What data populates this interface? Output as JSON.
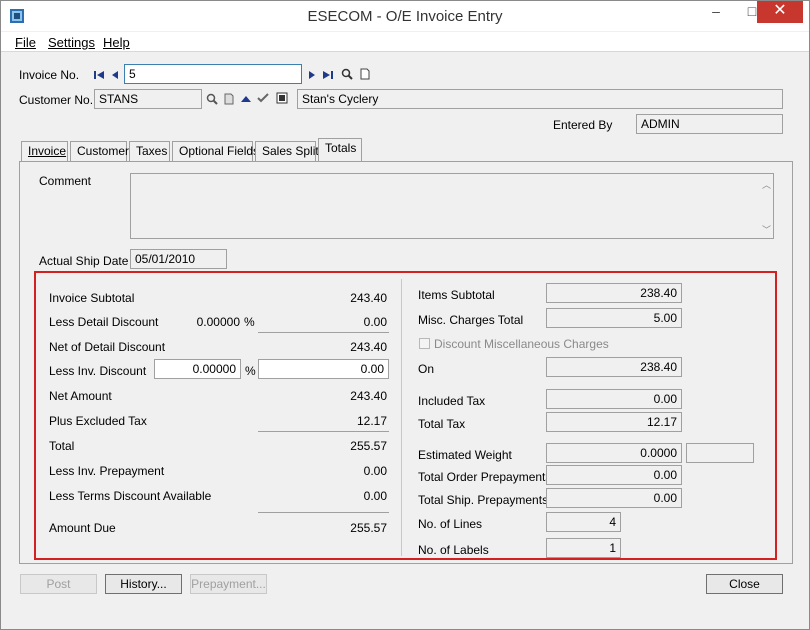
{
  "window": {
    "title": "ESECOM - O/E Invoice Entry",
    "min": "–",
    "max": "□",
    "close": "✕"
  },
  "menu": {
    "file": "File",
    "settings": "Settings",
    "help": "Help"
  },
  "header": {
    "invoice_label": "Invoice No.",
    "invoice_value": "5",
    "customer_label": "Customer No.",
    "customer_value": "STANS",
    "customer_name": "Stan's Cyclery",
    "entered_by_label": "Entered By",
    "entered_by_value": "ADMIN"
  },
  "tabs": [
    {
      "label": "Invoice"
    },
    {
      "label": "Customer"
    },
    {
      "label": "Taxes"
    },
    {
      "label": "Optional Fields"
    },
    {
      "label": "Sales Split"
    },
    {
      "label": "Totals"
    }
  ],
  "totals": {
    "comment_label": "Comment",
    "comment_value": "",
    "ship_date_label": "Actual Ship Date",
    "ship_date_value": "05/01/2010",
    "left": {
      "invoice_subtotal_label": "Invoice Subtotal",
      "invoice_subtotal": "243.40",
      "less_detail_discount_label": "Less Detail Discount",
      "detail_discount_pct": "0.00000",
      "pct_sign": "%",
      "detail_discount_amt": "0.00",
      "net_of_detail_label": "Net of Detail Discount",
      "net_of_detail": "243.40",
      "less_inv_discount_label": "Less Inv. Discount",
      "inv_discount_pct": "0.00000",
      "inv_discount_amt": "0.00",
      "net_amount_label": "Net Amount",
      "net_amount": "243.40",
      "plus_excluded_tax_label": "Plus Excluded Tax",
      "plus_excluded_tax": "12.17",
      "total_label": "Total",
      "total": "255.57",
      "less_inv_prepayment_label": "Less Inv. Prepayment",
      "less_inv_prepayment": "0.00",
      "less_terms_discount_label": "Less Terms Discount Available",
      "less_terms_discount": "0.00",
      "amount_due_label": "Amount Due",
      "amount_due": "255.57"
    },
    "right": {
      "items_subtotal_label": "Items Subtotal",
      "items_subtotal": "238.40",
      "misc_charges_label": "Misc. Charges Total",
      "misc_charges": "5.00",
      "discount_misc_label": "Discount Miscellaneous Charges",
      "on_label": "On",
      "on_value": "238.40",
      "included_tax_label": "Included Tax",
      "included_tax": "0.00",
      "total_tax_label": "Total Tax",
      "total_tax": "12.17",
      "est_weight_label": "Estimated Weight",
      "est_weight": "0.0000",
      "est_weight_unit": "",
      "total_order_prepay_label": "Total Order Prepayments",
      "total_order_prepay": "0.00",
      "total_ship_prepay_label": "Total Ship. Prepayments",
      "total_ship_prepay": "0.00",
      "no_lines_label": "No. of Lines",
      "no_lines": "4",
      "no_labels_label": "No. of Labels",
      "no_labels": "1"
    }
  },
  "buttons": {
    "post": "Post",
    "history": "History...",
    "prepayment": "Prepayment...",
    "close": "Close"
  },
  "colors": {
    "highlight_border": "#d32020",
    "close_button": "#c8372d",
    "active_field_border": "#3c7fb1"
  }
}
